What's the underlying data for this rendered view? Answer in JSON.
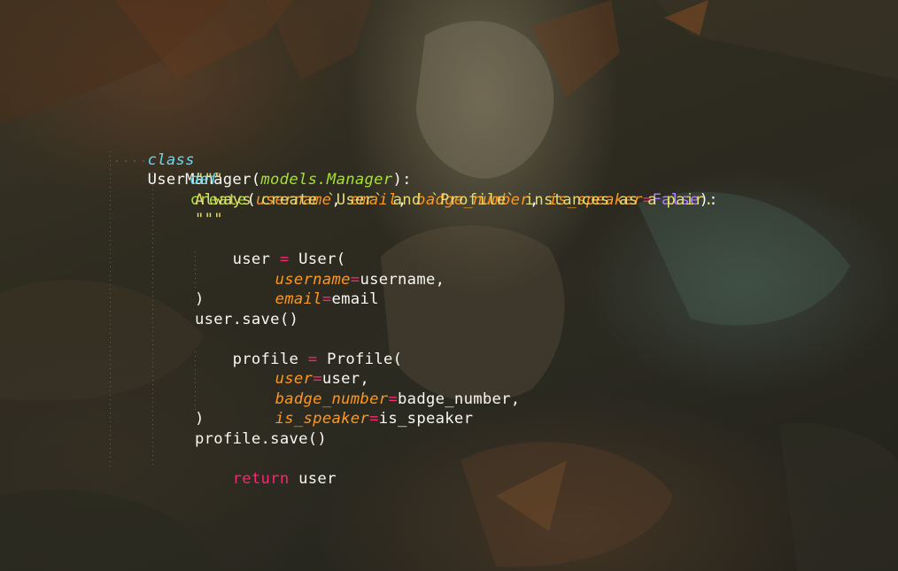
{
  "code": {
    "line1": {
      "kw": "class",
      "name": "UserManager",
      "open": "(",
      "base": "models.Manager",
      "close": "):"
    },
    "line2": {
      "kw": "def",
      "fname": "create",
      "open": "(",
      "p1": "username",
      "sep1": ", ",
      "p2": "email",
      "sep2": ", ",
      "p3": "badge_number",
      "sep3": ", ",
      "p4": "is_speaker",
      "eq": "=",
      "default": "False",
      "close": "):"
    },
    "line3": {
      "text": "\"\"\""
    },
    "line4": {
      "text": "Always create `User` and `Profile` instances as a pair."
    },
    "line5": {
      "text": "\"\"\""
    },
    "line6": {
      "var": "user",
      "eq": " = ",
      "call": "User("
    },
    "line7": {
      "key": "username",
      "eq": "=",
      "val": "username,"
    },
    "line8": {
      "key": "email",
      "eq": "=",
      "val": "email"
    },
    "line9": {
      "text": ")"
    },
    "line10": {
      "text": "user.save()"
    },
    "line11": {
      "var": "profile",
      "eq": " = ",
      "call": "Profile("
    },
    "line12": {
      "key": "user",
      "eq": "=",
      "val": "user,"
    },
    "line13": {
      "key": "badge_number",
      "eq": "=",
      "val": "badge_number,"
    },
    "line14": {
      "key": "is_speaker",
      "eq": "=",
      "val": "is_speaker"
    },
    "line15": {
      "text": ")"
    },
    "line16": {
      "text": "profile.save()"
    },
    "line17": {
      "kw": "return",
      "val": " user"
    }
  },
  "colors": {
    "keyword": "#66d9ef",
    "function": "#a6e22e",
    "parameter": "#fd971f",
    "operator": "#f92672",
    "constant": "#ae81ff",
    "string": "#e6db74",
    "text": "#f8f8f2"
  }
}
